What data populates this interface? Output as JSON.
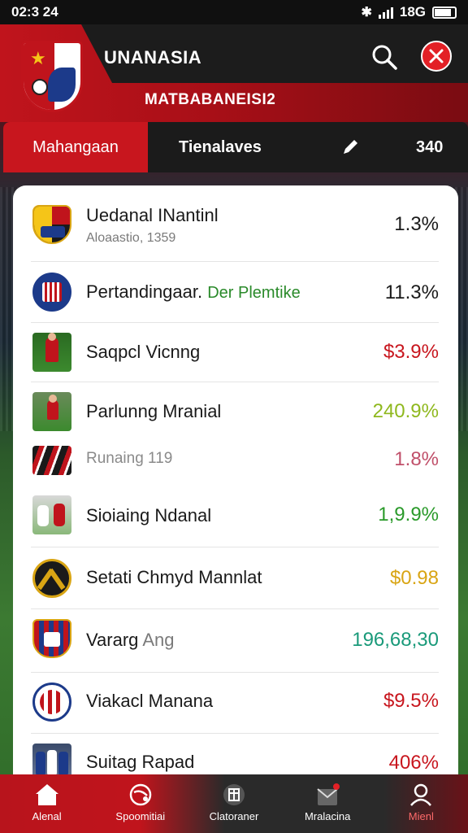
{
  "status_bar": {
    "time": "02:3 24",
    "right_text": "18G"
  },
  "header": {
    "title": "UNANASIA",
    "subtitle": "MATBABANEISI2"
  },
  "tabs": {
    "active_label": "Mahangaan",
    "second_label": "Tienalaves",
    "count": "340"
  },
  "list": [
    {
      "name": "Uedanal INantinl",
      "meta": "Aloaastio, 1359",
      "value": "1.3%",
      "value_color": "#1a1a1a"
    },
    {
      "name": "Pertandingaar.",
      "name_extra": "Der Plemtike",
      "value": "11.3%",
      "value_color": "#1a1a1a"
    },
    {
      "name": "Saqpcl Vicnng",
      "value": "$3.9%",
      "value_color": "#c8161e"
    },
    {
      "name": "Parlunng Mranial",
      "value": "240.9%",
      "value_color": "#8fb81e"
    },
    {
      "name": "Runaing 119",
      "value": "1.8%",
      "value_color": "#c0506a"
    },
    {
      "name": "Sioiaing Ndanal",
      "value": "1,9.9%",
      "value_color": "#2a9a2a"
    },
    {
      "name": "Setati Chmyd Mannlat",
      "value": "$0.98",
      "value_color": "#d9a514"
    },
    {
      "name": "Vararg",
      "name_extra": "Ang",
      "value": "196,68,30",
      "value_color": "#1a9a7a"
    },
    {
      "name": "Viakacl Manana",
      "value": "$9.5%",
      "value_color": "#c8161e"
    },
    {
      "name": "Suitag Rapad",
      "value": "406%",
      "value_color": "#c8161e"
    }
  ],
  "bottom_nav": [
    {
      "label": "Alenal",
      "icon": "home-icon"
    },
    {
      "label": "Spoomitiai",
      "icon": "sports-icon"
    },
    {
      "label": "Clatoraner",
      "icon": "calendar-icon"
    },
    {
      "label": "Mralacina",
      "icon": "inbox-icon"
    },
    {
      "label": "Mienl",
      "icon": "profile-icon"
    }
  ]
}
